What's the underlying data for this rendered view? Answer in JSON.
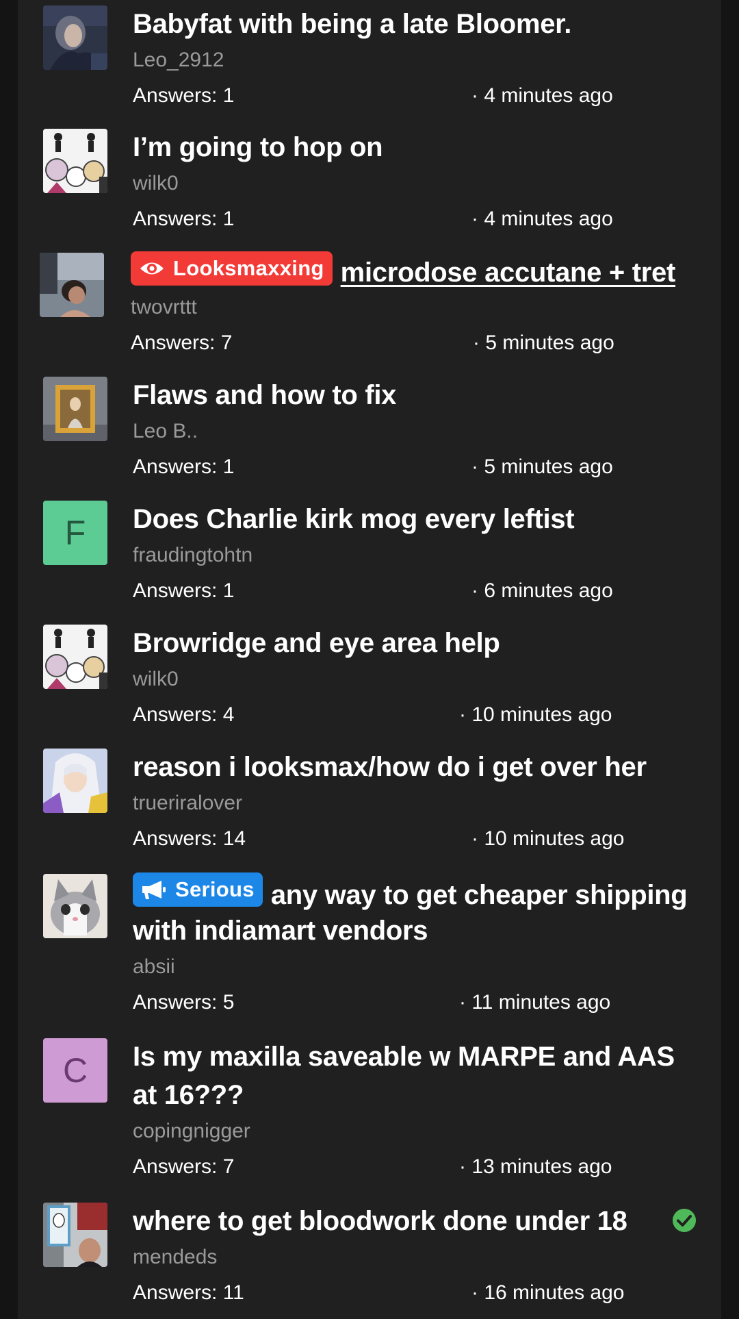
{
  "threads": [
    {
      "title": "Babyfat with being a late Bloomer.",
      "author": "Leo_2912",
      "answers": "Answers: 1",
      "time": "· 4 minutes ago"
    },
    {
      "title": "I’m going to hop on",
      "author": "wilk0",
      "answers": "Answers: 1",
      "time": "· 4 minutes ago"
    },
    {
      "tag": "Looksmaxxing",
      "tag_color": "#f23a37",
      "tag_icon": "eye-icon",
      "title": "microdose accutane + tret",
      "author": "twovrttt",
      "answers": "Answers: 7",
      "time": "· 5 minutes ago"
    },
    {
      "title": "Flaws and how to fix",
      "author": "Leo B..",
      "answers": "Answers: 1",
      "time": "· 5 minutes ago"
    },
    {
      "title": "Does Charlie kirk mog every leftist",
      "author": "fraudingtohtn",
      "avatar_letter": "F",
      "avatar_color": "#5ccb94",
      "answers": "Answers: 1",
      "time": "· 6 minutes ago"
    },
    {
      "title": "Browridge and eye area help",
      "author": "wilk0",
      "answers": "Answers: 4",
      "time": "· 10 minutes ago"
    },
    {
      "title": "reason i looksmax/how do i get over her",
      "author": "trueriralover",
      "answers": "Answers: 14",
      "time": "· 10 minutes ago"
    },
    {
      "tag": "Serious",
      "tag_color": "#1d87e8",
      "tag_icon": "megaphone-icon",
      "title_line1": "any way to get cheaper shipping",
      "title_line2": "with indiamart vendors",
      "author": "absii",
      "answers": "Answers: 5",
      "time": "· 11 minutes ago"
    },
    {
      "title_line1": "Is my maxilla saveable w MARPE and AAS",
      "title_line2": "at 16???",
      "author": "copingnigger",
      "avatar_letter": "C",
      "avatar_color": "#cf9bd4",
      "answers": "Answers: 7",
      "time": "· 13 minutes ago"
    },
    {
      "title": "where to get bloodwork done under 18",
      "author": "mendeds",
      "answers": "Answers: 11",
      "time": "· 16 minutes ago",
      "status_icon": "check-circle-icon",
      "status_color": "#4fb95a"
    }
  ]
}
